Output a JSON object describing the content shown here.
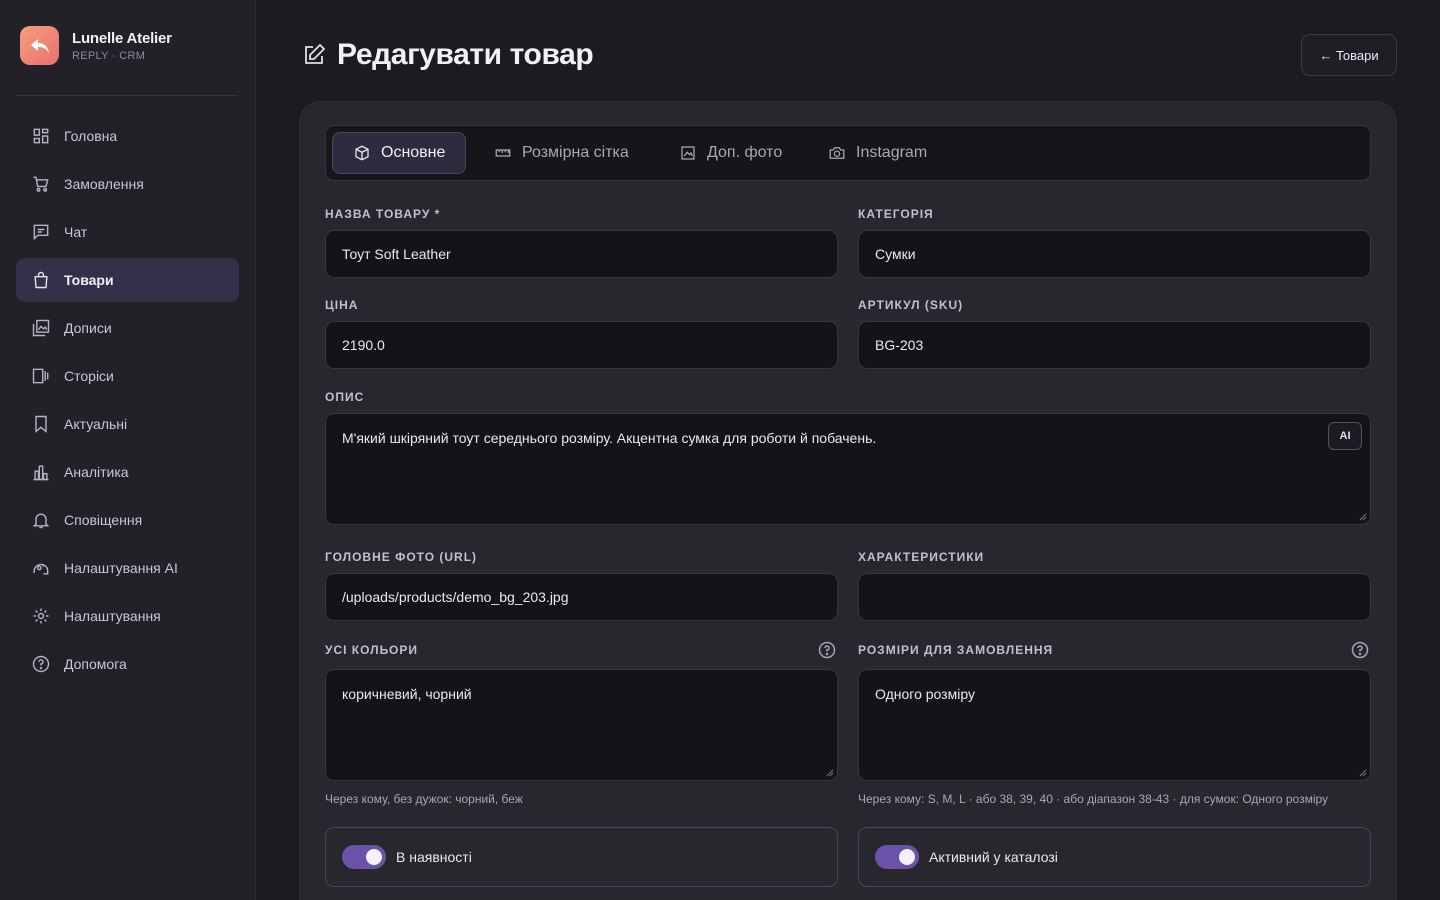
{
  "brand": {
    "name": "Lunelle Atelier",
    "sub": "REPLY · CRM"
  },
  "sidebar": {
    "items": [
      {
        "label": "Головна",
        "icon": "dashboard-icon"
      },
      {
        "label": "Замовлення",
        "icon": "cart-icon"
      },
      {
        "label": "Чат",
        "icon": "chat-icon"
      },
      {
        "label": "Товари",
        "icon": "bag-icon",
        "active": true
      },
      {
        "label": "Дописи",
        "icon": "gallery-icon"
      },
      {
        "label": "Сторіси",
        "icon": "stories-icon"
      },
      {
        "label": "Актуальні",
        "icon": "bookmark-icon"
      },
      {
        "label": "Аналітика",
        "icon": "analytics-icon"
      },
      {
        "label": "Сповіщення",
        "icon": "bell-icon"
      },
      {
        "label": "Налаштування AI",
        "icon": "ai-settings-icon"
      },
      {
        "label": "Налаштування",
        "icon": "gear-icon"
      },
      {
        "label": "Допомога",
        "icon": "help-icon"
      }
    ]
  },
  "header": {
    "title": "Редагувати товар",
    "back_label": "← Товари"
  },
  "tabs": [
    {
      "label": "Основне",
      "icon": "box-icon",
      "active": true
    },
    {
      "label": "Розмірна сітка",
      "icon": "ruler-icon"
    },
    {
      "label": "Доп. фото",
      "icon": "image-icon"
    },
    {
      "label": "Instagram",
      "icon": "camera-icon"
    }
  ],
  "form": {
    "name_label": "НАЗВА ТОВАРУ *",
    "name_value": "Тоут Soft Leather",
    "category_label": "КАТЕГОРІЯ",
    "category_value": "Сумки",
    "price_label": "ЦІНА",
    "price_value": "2190.0",
    "sku_label": "АРТИКУЛ (SKU)",
    "sku_value": "BG-203",
    "desc_label": "ОПИС",
    "desc_value": "М'який шкіряний тоут середнього розміру. Акцентна сумка для роботи й побачень.",
    "ai_label": "AI",
    "photo_label": "ГОЛОВНЕ ФОТО (URL)",
    "photo_value": "/uploads/products/demo_bg_203.jpg",
    "specs_label": "ХАРАКТЕРИСТИКИ",
    "specs_value": "",
    "colors_label": "УСІ КОЛЬОРИ",
    "colors_value": "коричневий, чорний",
    "colors_hint": "Через кому, без дужок: чорний, беж",
    "sizes_label": "РОЗМІРИ ДЛЯ ЗАМОВЛЕННЯ",
    "sizes_value": "Одного розміру",
    "sizes_hint": "Через кому: S, M, L · або 38, 39, 40 · або діапазон 38-43 · для сумок: Одного розміру",
    "in_stock_label": "В наявності",
    "in_stock": true,
    "active_label": "Активний у каталозі",
    "active": true
  },
  "colors": {
    "accent": "#6a52a8",
    "active_nav": "#35304a",
    "brand_start": "#f5a07a",
    "brand_end": "#e86f73"
  }
}
